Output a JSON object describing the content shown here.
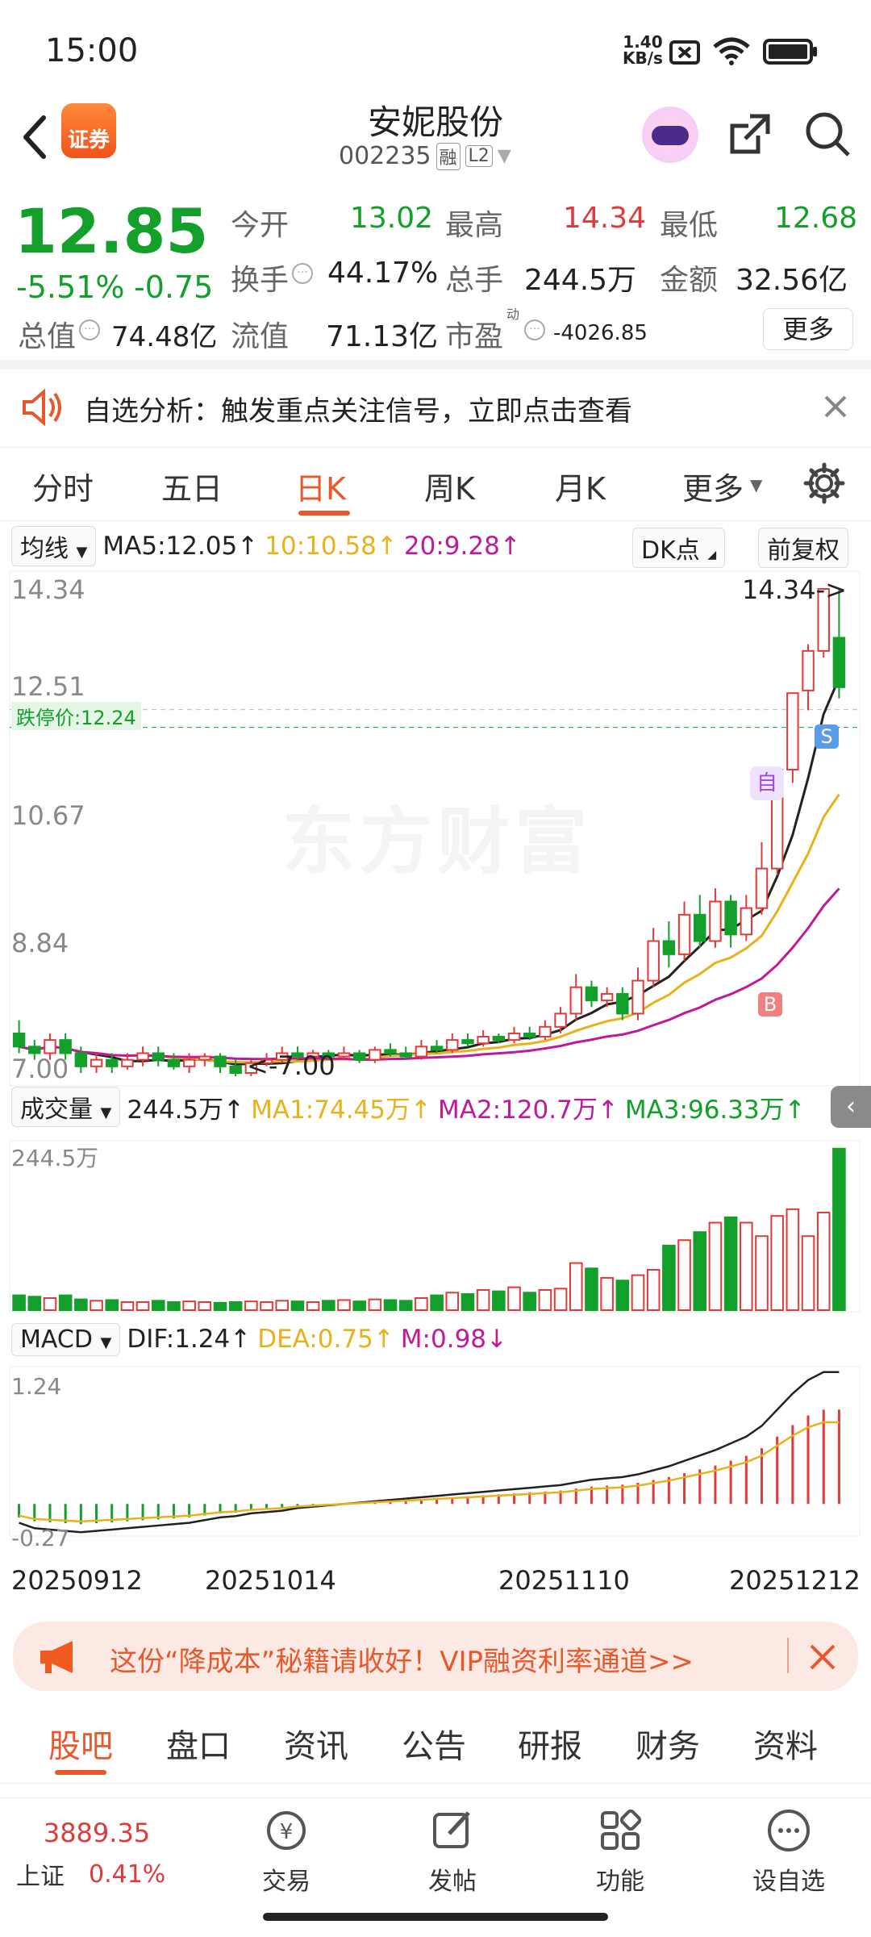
{
  "status": {
    "time": "15:00",
    "net_speed_top": "1.40",
    "net_speed_bottom": "KB/s"
  },
  "header": {
    "title": "安妮股份",
    "code": "002235",
    "tag1": "融",
    "tag2": "L2",
    "logo_text": "证券"
  },
  "quote": {
    "price": "12.85",
    "change_pct": "-5.51%",
    "change_amt": "-0.75",
    "open_label": "今开",
    "open": "13.02",
    "high_label": "最高",
    "high": "14.34",
    "low_label": "最低",
    "low": "12.68",
    "turnover_label": "换手",
    "turnover": "44.17%",
    "volume_label": "总手",
    "volume": "244.5万",
    "amount_label": "金额",
    "amount": "32.56亿",
    "mcap_label": "总值",
    "mcap": "74.48亿",
    "float_label": "流值",
    "float": "71.13亿",
    "pe_label": "市盈",
    "pe_sup": "动",
    "pe": "-4026.85",
    "more_btn": "更多"
  },
  "notice": {
    "text": "自选分析：触发重点关注信号，立即点击查看"
  },
  "tabs": [
    "分时",
    "五日",
    "日K",
    "周K",
    "月K",
    "更多"
  ],
  "active_tab": 2,
  "kline": {
    "indicator": "均线",
    "ma5": "MA5:12.05",
    "ma10": "10:10.58",
    "ma20": "20:9.28",
    "dk": "DK点",
    "adjust": "前复权",
    "y_labels": [
      "14.34",
      "12.51",
      "10.67",
      "8.84",
      "7.00"
    ],
    "limit_down": "跌停价:12.24",
    "high_marker": "14.34->",
    "low_marker": "<-7.00",
    "watermark": "东方财富",
    "mark_s": "S",
    "mark_b": "B",
    "mark_self": "自"
  },
  "volume": {
    "label": "成交量",
    "value": "244.5万",
    "ma1": "MA1:74.45万",
    "ma2": "MA2:120.7万",
    "ma3": "MA3:96.33万",
    "axis_max": "244.5万"
  },
  "macd": {
    "label": "MACD",
    "dif": "DIF:1.24",
    "dea": "DEA:0.75",
    "m": "M:0.98",
    "axis_max": "1.24",
    "axis_min": "-0.27"
  },
  "dates": [
    "20250912",
    "20251014",
    "20251110",
    "20251212"
  ],
  "ad": {
    "text": "这份“降成本”秘籍请收好！VIP融资利率通道>>"
  },
  "bottom_tabs": [
    "股吧",
    "盘口",
    "资讯",
    "公告",
    "研报",
    "财务",
    "资料"
  ],
  "bottom_nav": {
    "index_value": "3889.35",
    "index_name": "上证",
    "index_pct": "0.41%",
    "items": [
      "交易",
      "发帖",
      "功能",
      "设自选"
    ]
  },
  "colors": {
    "up": "#e03a3a",
    "down": "#12a02a",
    "accent": "#e8582a",
    "ma5": "#222222",
    "ma10": "#e8b21c",
    "ma20": "#c0199a"
  },
  "chart_data": {
    "type": "candlestick",
    "price_axis": [
      7.0,
      14.34
    ],
    "candles": [
      [
        7.6,
        7.4,
        7.8,
        7.3
      ],
      [
        7.4,
        7.3,
        7.5,
        7.2
      ],
      [
        7.3,
        7.5,
        7.6,
        7.2
      ],
      [
        7.5,
        7.3,
        7.6,
        7.2
      ],
      [
        7.3,
        7.1,
        7.4,
        7.0
      ],
      [
        7.1,
        7.2,
        7.3,
        7.0
      ],
      [
        7.2,
        7.1,
        7.3,
        7.0
      ],
      [
        7.1,
        7.2,
        7.3,
        7.05
      ],
      [
        7.2,
        7.3,
        7.4,
        7.1
      ],
      [
        7.3,
        7.2,
        7.4,
        7.1
      ],
      [
        7.2,
        7.1,
        7.3,
        7.05
      ],
      [
        7.1,
        7.2,
        7.3,
        7.0
      ],
      [
        7.2,
        7.25,
        7.3,
        7.1
      ],
      [
        7.25,
        7.1,
        7.3,
        7.0
      ],
      [
        7.1,
        7.0,
        7.2,
        6.95
      ],
      [
        7.0,
        7.15,
        7.2,
        6.95
      ],
      [
        7.15,
        7.2,
        7.3,
        7.1
      ],
      [
        7.2,
        7.3,
        7.4,
        7.15
      ],
      [
        7.3,
        7.25,
        7.4,
        7.2
      ],
      [
        7.25,
        7.3,
        7.35,
        7.2
      ],
      [
        7.3,
        7.25,
        7.35,
        7.2
      ],
      [
        7.25,
        7.3,
        7.4,
        7.2
      ],
      [
        7.3,
        7.2,
        7.35,
        7.15
      ],
      [
        7.2,
        7.35,
        7.4,
        7.15
      ],
      [
        7.35,
        7.3,
        7.45,
        7.25
      ],
      [
        7.3,
        7.25,
        7.4,
        7.2
      ],
      [
        7.25,
        7.4,
        7.5,
        7.2
      ],
      [
        7.4,
        7.35,
        7.5,
        7.3
      ],
      [
        7.35,
        7.5,
        7.6,
        7.3
      ],
      [
        7.5,
        7.45,
        7.6,
        7.4
      ],
      [
        7.45,
        7.55,
        7.65,
        7.4
      ],
      [
        7.55,
        7.5,
        7.6,
        7.45
      ],
      [
        7.5,
        7.6,
        7.7,
        7.45
      ],
      [
        7.6,
        7.55,
        7.7,
        7.5
      ],
      [
        7.55,
        7.7,
        7.8,
        7.5
      ],
      [
        7.7,
        7.9,
        8.0,
        7.6
      ],
      [
        7.9,
        8.3,
        8.5,
        7.8
      ],
      [
        8.3,
        8.1,
        8.4,
        8.0
      ],
      [
        8.1,
        8.2,
        8.3,
        8.0
      ],
      [
        8.2,
        7.9,
        8.3,
        7.8
      ],
      [
        7.9,
        8.4,
        8.6,
        7.8
      ],
      [
        8.4,
        9.0,
        9.2,
        8.3
      ],
      [
        9.0,
        8.8,
        9.3,
        8.6
      ],
      [
        8.8,
        9.4,
        9.6,
        8.7
      ],
      [
        9.4,
        9.0,
        9.7,
        8.9
      ],
      [
        9.0,
        9.6,
        9.8,
        8.9
      ],
      [
        9.6,
        9.1,
        9.7,
        8.9
      ],
      [
        9.1,
        9.5,
        9.7,
        9.0
      ],
      [
        9.5,
        10.1,
        10.5,
        9.4
      ],
      [
        10.1,
        11.6,
        11.6,
        10.0
      ],
      [
        11.6,
        12.76,
        12.76,
        11.4
      ],
      [
        12.8,
        13.4,
        13.5,
        12.5
      ],
      [
        13.4,
        14.34,
        14.34,
        13.3
      ],
      [
        13.6,
        12.85,
        14.34,
        12.68
      ]
    ],
    "volume": [
      22,
      20,
      18,
      22,
      16,
      14,
      15,
      12,
      12,
      14,
      12,
      13,
      12,
      11,
      12,
      13,
      12,
      14,
      13,
      12,
      14,
      15,
      13,
      16,
      15,
      14,
      18,
      22,
      26,
      24,
      30,
      28,
      34,
      26,
      30,
      32,
      70,
      62,
      48,
      44,
      52,
      60,
      96,
      104,
      116,
      130,
      138,
      130,
      110,
      140,
      150,
      110,
      145,
      240
    ],
    "vol_axis_max": 244.5,
    "macd": [
      -0.14,
      -0.18,
      -0.19,
      -0.2,
      -0.21,
      -0.2,
      -0.19,
      -0.18,
      -0.17,
      -0.16,
      -0.15,
      -0.14,
      -0.12,
      -0.1,
      -0.09,
      -0.07,
      -0.06,
      -0.05,
      -0.03,
      -0.02,
      -0.01,
      0.0,
      0.01,
      0.02,
      0.03,
      0.04,
      0.05,
      0.06,
      0.07,
      0.08,
      0.09,
      0.1,
      0.11,
      0.12,
      0.13,
      0.14,
      0.16,
      0.18,
      0.19,
      0.2,
      0.22,
      0.25,
      0.28,
      0.32,
      0.36,
      0.4,
      0.45,
      0.5,
      0.58,
      0.7,
      0.82,
      0.92,
      0.98,
      0.98
    ],
    "macd_axis": [
      -0.27,
      1.24
    ]
  }
}
